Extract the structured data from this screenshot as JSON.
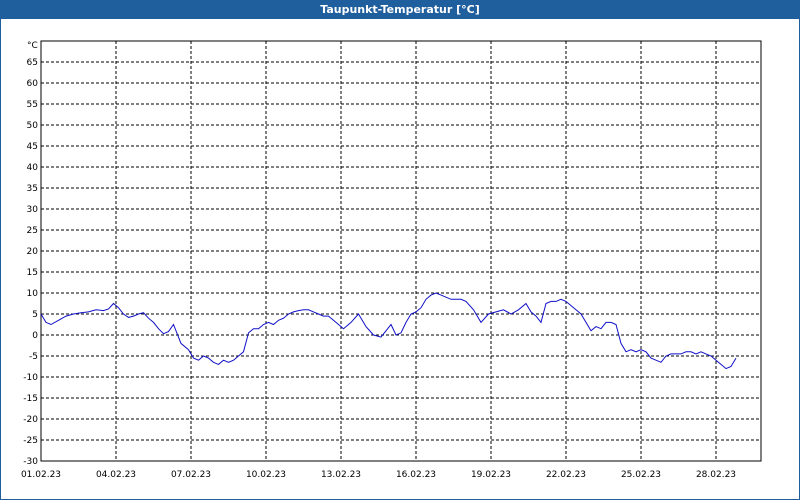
{
  "window": {
    "title": "Taupunkt-Temperatur [°C]"
  },
  "colors": {
    "titlebar": "#1f5f9e",
    "line": "#1010c8",
    "grid": "#000000",
    "background": "#ffffff"
  },
  "chart_data": {
    "type": "line",
    "title": "Taupunkt-Temperatur [°C]",
    "ylabel": "°C",
    "xlabel": "",
    "grid": true,
    "ylim": [
      -30,
      70
    ],
    "y_ticks": [
      65,
      60,
      55,
      50,
      45,
      40,
      35,
      30,
      25,
      20,
      15,
      10,
      5,
      0,
      -5,
      -10,
      -15,
      -20,
      -25,
      -30
    ],
    "x_tick_labels": [
      "01.02.23",
      "04.02.23",
      "07.02.23",
      "10.02.23",
      "13.02.23",
      "16.02.23",
      "19.02.23",
      "22.02.23",
      "25.02.23",
      "28.02.23"
    ],
    "xlim_days": [
      0,
      28.8
    ],
    "series": [
      {
        "x_days": [
          0,
          0.2,
          0.4,
          0.7,
          1.0,
          1.3,
          1.6,
          1.9,
          2.2,
          2.5,
          2.7,
          2.9,
          3.1,
          3.3,
          3.5,
          3.7,
          3.9,
          4.1,
          4.3,
          4.5,
          4.7,
          4.9,
          5.1,
          5.3,
          5.6,
          5.9,
          6.1,
          6.3,
          6.5,
          6.7,
          6.9,
          7.1,
          7.3,
          7.5,
          7.7,
          7.9,
          8.1,
          8.3,
          8.5,
          8.7,
          8.9,
          9.1,
          9.3,
          9.5,
          9.7,
          9.9,
          10.1,
          10.3,
          10.5,
          10.7,
          10.9,
          11.1,
          11.3,
          11.5,
          11.8,
          12.1,
          12.4,
          12.7,
          13.0,
          13.3,
          13.6,
          13.8,
          14.0,
          14.2,
          14.4,
          14.6,
          14.8,
          15.0,
          15.2,
          15.4,
          15.6,
          15.8,
          16.0,
          16.2,
          16.4,
          16.6,
          16.8,
          17.0,
          17.3,
          17.6,
          17.9,
          18.2,
          18.5,
          18.8,
          19.1,
          19.4,
          19.6,
          19.8,
          20.0,
          20.2,
          20.4,
          20.6,
          20.8,
          21.0,
          21.2,
          21.4,
          21.6,
          21.8,
          22.0,
          22.2,
          22.4,
          22.6,
          22.8,
          23.0,
          23.2,
          23.4,
          23.6,
          23.8,
          24.0,
          24.2,
          24.4,
          24.6,
          24.8,
          25.0,
          25.2,
          25.4,
          25.6,
          25.8,
          26.0,
          26.2,
          26.4,
          26.6,
          26.8,
          27.0,
          27.2,
          27.4,
          27.6,
          27.8,
          28.0,
          28.2,
          28.4,
          28.6
        ],
        "y": [
          5,
          3,
          2.5,
          3.5,
          4.5,
          5,
          5.3,
          5.5,
          6,
          5.8,
          6.2,
          7.5,
          6.5,
          5,
          4.2,
          4.5,
          5,
          5.3,
          4,
          3,
          1.5,
          0.3,
          0.8,
          2.5,
          -2,
          -3.5,
          -5.5,
          -6,
          -5,
          -5.5,
          -6.5,
          -7,
          -6,
          -6.5,
          -6,
          -5,
          -4,
          0.5,
          1.5,
          1.5,
          2.5,
          3,
          2.5,
          3.5,
          4,
          5,
          5.5,
          5.8,
          6,
          6,
          5.5,
          5,
          4.5,
          4.5,
          3,
          1.5,
          3,
          5,
          2,
          0,
          -0.5,
          1,
          2.5,
          0,
          0.5,
          3,
          5,
          5.5,
          6.5,
          8.5,
          9.5,
          10,
          9.5,
          9,
          8.5,
          8.5,
          8.5,
          8,
          6,
          3,
          5,
          5.5,
          6,
          5,
          6,
          7.5,
          5.5,
          4.5,
          3,
          7.5,
          8,
          8,
          8.5,
          8,
          7,
          6,
          5,
          3,
          1,
          2,
          1.5,
          3,
          3,
          2.5,
          -2,
          -4,
          -3.5,
          -4,
          -3.5,
          -4,
          -5.5,
          -6,
          -6.5,
          -5,
          -4.5,
          -4.5,
          -4.5,
          -4,
          -4,
          -4.5,
          -4,
          -4.5,
          -5,
          -6,
          -7,
          -8,
          -7.5,
          -5.5
        ]
      }
    ]
  }
}
